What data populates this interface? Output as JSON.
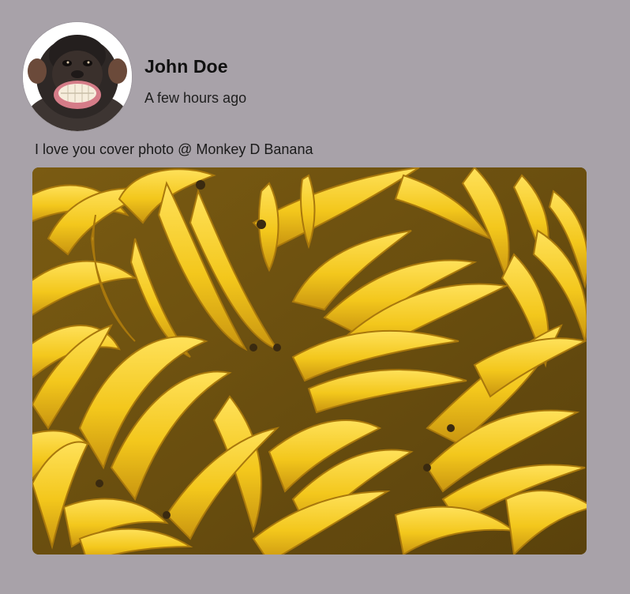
{
  "post": {
    "author": {
      "name": "John Doe",
      "avatar_icon": "monkey-avatar"
    },
    "timestamp": "A few hours ago",
    "text": "I love you cover photo @ Monkey D Banana",
    "image": {
      "subject": "bananas-photo"
    }
  },
  "colors": {
    "background": "#a8a2a9",
    "banana_yellow": "#f2c81e",
    "banana_shadow": "#c99a10"
  }
}
